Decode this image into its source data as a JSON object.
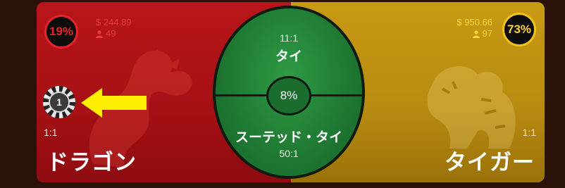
{
  "dragon": {
    "percent": "19%",
    "amount": "$ 244.89",
    "players": "49",
    "ratio": "1:1",
    "label": "ドラゴン"
  },
  "tie": {
    "ratio": "11:1",
    "label": "タイ",
    "percent": "8%"
  },
  "suited_tie": {
    "label": "スーテッド・タイ",
    "ratio": "50:1"
  },
  "tiger": {
    "percent": "73%",
    "amount": "$ 950.66",
    "players": "97",
    "ratio": "1:1",
    "label": "タイガー"
  },
  "chip": {
    "value": "1"
  },
  "colors": {
    "dragon": "#b8161a",
    "tiger": "#c99a12",
    "tie": "#1f7a33",
    "arrow": "#ffee00"
  },
  "icons": {
    "players": "person-icon",
    "dragon_art": "dragon-icon",
    "tiger_art": "tiger-icon",
    "pointer": "arrow-left-icon"
  }
}
